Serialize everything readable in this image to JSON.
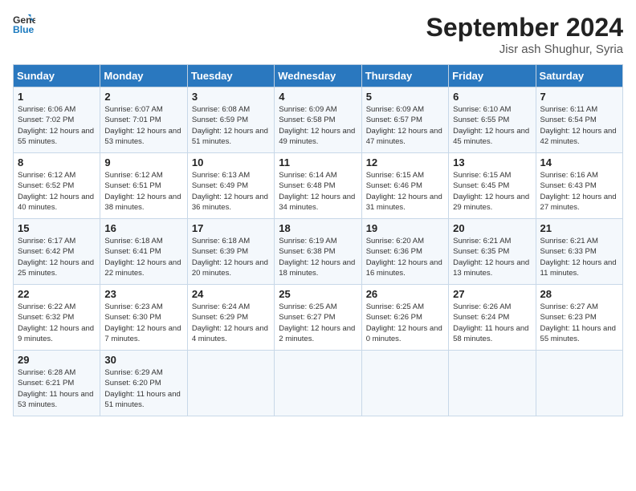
{
  "header": {
    "logo_line1": "General",
    "logo_line2": "Blue",
    "month": "September 2024",
    "location": "Jisr ash Shughur, Syria"
  },
  "days_of_week": [
    "Sunday",
    "Monday",
    "Tuesday",
    "Wednesday",
    "Thursday",
    "Friday",
    "Saturday"
  ],
  "weeks": [
    [
      {
        "num": "1",
        "sunrise": "6:06 AM",
        "sunset": "7:02 PM",
        "daylight": "12 hours and 55 minutes."
      },
      {
        "num": "2",
        "sunrise": "6:07 AM",
        "sunset": "7:01 PM",
        "daylight": "12 hours and 53 minutes."
      },
      {
        "num": "3",
        "sunrise": "6:08 AM",
        "sunset": "6:59 PM",
        "daylight": "12 hours and 51 minutes."
      },
      {
        "num": "4",
        "sunrise": "6:09 AM",
        "sunset": "6:58 PM",
        "daylight": "12 hours and 49 minutes."
      },
      {
        "num": "5",
        "sunrise": "6:09 AM",
        "sunset": "6:57 PM",
        "daylight": "12 hours and 47 minutes."
      },
      {
        "num": "6",
        "sunrise": "6:10 AM",
        "sunset": "6:55 PM",
        "daylight": "12 hours and 45 minutes."
      },
      {
        "num": "7",
        "sunrise": "6:11 AM",
        "sunset": "6:54 PM",
        "daylight": "12 hours and 42 minutes."
      }
    ],
    [
      {
        "num": "8",
        "sunrise": "6:12 AM",
        "sunset": "6:52 PM",
        "daylight": "12 hours and 40 minutes."
      },
      {
        "num": "9",
        "sunrise": "6:12 AM",
        "sunset": "6:51 PM",
        "daylight": "12 hours and 38 minutes."
      },
      {
        "num": "10",
        "sunrise": "6:13 AM",
        "sunset": "6:49 PM",
        "daylight": "12 hours and 36 minutes."
      },
      {
        "num": "11",
        "sunrise": "6:14 AM",
        "sunset": "6:48 PM",
        "daylight": "12 hours and 34 minutes."
      },
      {
        "num": "12",
        "sunrise": "6:15 AM",
        "sunset": "6:46 PM",
        "daylight": "12 hours and 31 minutes."
      },
      {
        "num": "13",
        "sunrise": "6:15 AM",
        "sunset": "6:45 PM",
        "daylight": "12 hours and 29 minutes."
      },
      {
        "num": "14",
        "sunrise": "6:16 AM",
        "sunset": "6:43 PM",
        "daylight": "12 hours and 27 minutes."
      }
    ],
    [
      {
        "num": "15",
        "sunrise": "6:17 AM",
        "sunset": "6:42 PM",
        "daylight": "12 hours and 25 minutes."
      },
      {
        "num": "16",
        "sunrise": "6:18 AM",
        "sunset": "6:41 PM",
        "daylight": "12 hours and 22 minutes."
      },
      {
        "num": "17",
        "sunrise": "6:18 AM",
        "sunset": "6:39 PM",
        "daylight": "12 hours and 20 minutes."
      },
      {
        "num": "18",
        "sunrise": "6:19 AM",
        "sunset": "6:38 PM",
        "daylight": "12 hours and 18 minutes."
      },
      {
        "num": "19",
        "sunrise": "6:20 AM",
        "sunset": "6:36 PM",
        "daylight": "12 hours and 16 minutes."
      },
      {
        "num": "20",
        "sunrise": "6:21 AM",
        "sunset": "6:35 PM",
        "daylight": "12 hours and 13 minutes."
      },
      {
        "num": "21",
        "sunrise": "6:21 AM",
        "sunset": "6:33 PM",
        "daylight": "12 hours and 11 minutes."
      }
    ],
    [
      {
        "num": "22",
        "sunrise": "6:22 AM",
        "sunset": "6:32 PM",
        "daylight": "12 hours and 9 minutes."
      },
      {
        "num": "23",
        "sunrise": "6:23 AM",
        "sunset": "6:30 PM",
        "daylight": "12 hours and 7 minutes."
      },
      {
        "num": "24",
        "sunrise": "6:24 AM",
        "sunset": "6:29 PM",
        "daylight": "12 hours and 4 minutes."
      },
      {
        "num": "25",
        "sunrise": "6:25 AM",
        "sunset": "6:27 PM",
        "daylight": "12 hours and 2 minutes."
      },
      {
        "num": "26",
        "sunrise": "6:25 AM",
        "sunset": "6:26 PM",
        "daylight": "12 hours and 0 minutes."
      },
      {
        "num": "27",
        "sunrise": "6:26 AM",
        "sunset": "6:24 PM",
        "daylight": "11 hours and 58 minutes."
      },
      {
        "num": "28",
        "sunrise": "6:27 AM",
        "sunset": "6:23 PM",
        "daylight": "11 hours and 55 minutes."
      }
    ],
    [
      {
        "num": "29",
        "sunrise": "6:28 AM",
        "sunset": "6:21 PM",
        "daylight": "11 hours and 53 minutes."
      },
      {
        "num": "30",
        "sunrise": "6:29 AM",
        "sunset": "6:20 PM",
        "daylight": "11 hours and 51 minutes."
      },
      null,
      null,
      null,
      null,
      null
    ]
  ]
}
